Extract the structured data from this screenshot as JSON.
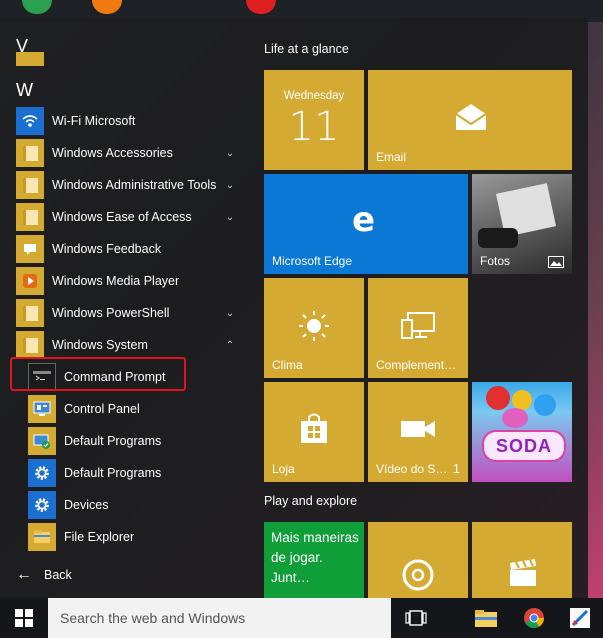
{
  "start_menu": {
    "section_v": "V",
    "section_w": "W",
    "apps": [
      {
        "label": "Wi-Fi Microsoft"
      },
      {
        "label": "Windows Accessories"
      },
      {
        "label": "Windows Administrative Tools"
      },
      {
        "label": "Windows Ease of Access"
      },
      {
        "label": "Windows Feedback"
      },
      {
        "label": "Windows Media Player"
      },
      {
        "label": "Windows PowerShell"
      },
      {
        "label": "Windows System"
      }
    ],
    "system_items": [
      {
        "label": "Command Prompt"
      },
      {
        "label": "Control Panel"
      },
      {
        "label": "Default Programs"
      },
      {
        "label": "Default Programs"
      },
      {
        "label": "Devices"
      },
      {
        "label": "File Explorer"
      }
    ],
    "back_label": "Back"
  },
  "tiles": {
    "group1_title": "Life at a glance",
    "group2_title": "Play and explore",
    "calendar_day": "Wednesday",
    "calendar_date": "11",
    "email": "Email",
    "edge": "Microsoft Edge",
    "photos": "Fotos",
    "weather": "Clima",
    "connect": "Complement…",
    "store": "Loja",
    "video": "Vídeo do S…",
    "video_badge": "1",
    "candy_text": "SODA",
    "xbox_text": "Mais maneiras de jogar. Junt…"
  },
  "taskbar": {
    "search_placeholder": "Search the web and Windows"
  },
  "colors": {
    "tile_gold": "#d4aa32",
    "tile_blue": "#0a78d4",
    "tile_green": "#109e38",
    "highlight_red": "#e0141e"
  }
}
